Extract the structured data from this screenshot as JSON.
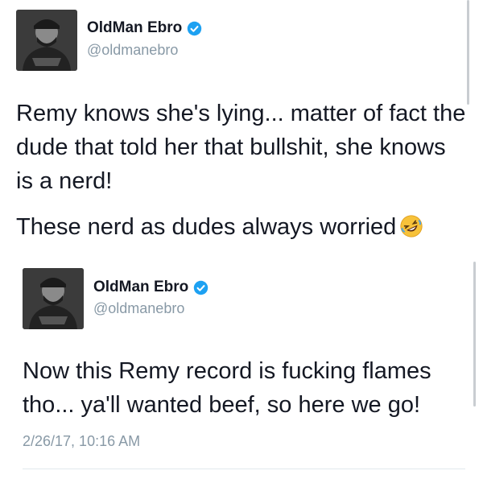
{
  "main_tweet": {
    "author": {
      "display_name": "OldMan Ebro",
      "handle": "@oldmanebro",
      "verified": true
    },
    "text": "Remy knows she's lying... matter of fact the dude that told her that bullshit, she knows is a nerd!",
    "text_line2": "These nerd as dudes always worried",
    "emoji": "rolling-on-floor-laughing-emoji"
  },
  "quoted_tweet": {
    "author": {
      "display_name": "OldMan Ebro",
      "handle": "@oldmanebro",
      "verified": true
    },
    "text": "Now this Remy record is fucking flames tho... ya'll wanted beef, so here we go!",
    "timestamp": "2/26/17, 10:16 AM"
  },
  "colors": {
    "verified_blue": "#1da1f2",
    "secondary_text": "#8899a6",
    "primary_text": "#141823",
    "divider": "#e1e8ed"
  }
}
